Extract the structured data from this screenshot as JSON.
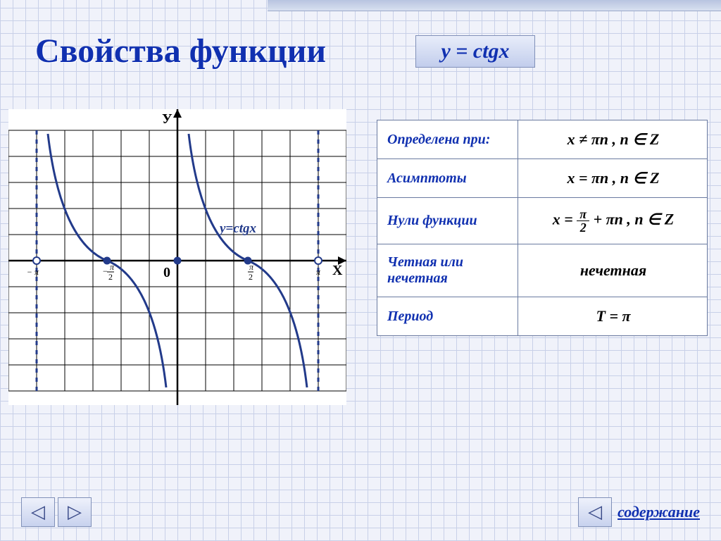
{
  "title": "Свойства функции",
  "function_badge": "у = ctgx",
  "properties": [
    {
      "key": "Определена при:",
      "val_html": "x ≠ πn , n ∈ Z"
    },
    {
      "key": "Асимптоты",
      "val_html": "x = πn , n ∈ Z"
    },
    {
      "key": "Нули  функции",
      "val_html": "x = <span class='frac'><span class='n'>π</span><span class='d'>2</span></span> + πn , n ∈ Z"
    },
    {
      "key": "Четная или нечетная",
      "val_html": "нечетная"
    },
    {
      "key": "Период",
      "val_html": "T = π"
    }
  ],
  "toc_label": "содержание",
  "chart_data": {
    "type": "line",
    "title": "",
    "function_label": "y=ctgx",
    "axis_y_label": "У",
    "axis_x_label": "Х",
    "origin_label": "0",
    "x_ticks": [
      "−π",
      "−π/2",
      "0",
      "π/2",
      "π"
    ],
    "asymptotes_x": [
      "−π",
      "0",
      "π"
    ],
    "zeros_x": [
      "−π/2",
      "π/2"
    ],
    "xlim": [
      "−1.2π",
      "1.2π"
    ],
    "ylim": [
      -5,
      5
    ],
    "series": [
      {
        "name": "ctg(x), branch (−π,0)",
        "domain": "(−π, 0)",
        "sample": [
          [
            "−0.95π",
            6.3
          ],
          [
            "−0.75π",
            1.0
          ],
          [
            "−π/2",
            0.0
          ],
          [
            "−0.25π",
            -1.0
          ],
          [
            "−0.05π",
            -6.3
          ]
        ]
      },
      {
        "name": "ctg(x), branch (0,π)",
        "domain": "(0, π)",
        "sample": [
          [
            "0.05π",
            6.3
          ],
          [
            "0.25π",
            1.0
          ],
          [
            "π/2",
            0.0
          ],
          [
            "0.75π",
            -1.0
          ],
          [
            "0.95π",
            -6.3
          ]
        ]
      }
    ]
  }
}
